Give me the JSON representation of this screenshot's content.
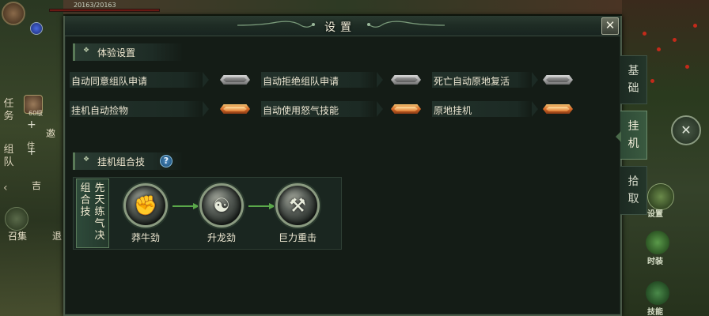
{
  "hud": {
    "hp_text": "20163/20163",
    "left_tabs": [
      "任务",
      "组队"
    ],
    "player_level": "60级",
    "left_menu": [
      "邀",
      "住",
      "吉"
    ],
    "left_bottom": [
      "召集",
      "退"
    ],
    "right_labels": [
      "设置",
      "时装",
      "技能"
    ]
  },
  "panel": {
    "title": "设置",
    "close_glyph": "✕"
  },
  "experience": {
    "heading": "体验设置",
    "options": [
      {
        "label": "自动同意组队申请",
        "on": false
      },
      {
        "label": "自动拒绝组队申请",
        "on": false
      },
      {
        "label": "死亡自动原地复活",
        "on": false
      },
      {
        "label": "挂机自动捡物",
        "on": true
      },
      {
        "label": "自动使用怒气技能",
        "on": true
      },
      {
        "label": "原地挂机",
        "on": true
      }
    ]
  },
  "combo": {
    "heading": "挂机组合技",
    "help_glyph": "?",
    "tab_col1": "组合技",
    "tab_col2": "先天练气决",
    "skills": [
      {
        "name": "莽牛劲",
        "icon": "fist-icon",
        "glyph": "✊"
      },
      {
        "name": "升龙劲",
        "icon": "dragon-icon",
        "glyph": "☯"
      },
      {
        "name": "巨力重击",
        "icon": "hammer-icon",
        "glyph": "⚒"
      }
    ]
  },
  "side_tabs": [
    {
      "label": "基础",
      "active": false
    },
    {
      "label": "挂机",
      "active": true
    },
    {
      "label": "拾取",
      "active": false
    }
  ],
  "colors": {
    "toggle_on": "#d86a28",
    "toggle_off": "#a8a8a8",
    "panel_bg": "#141c16",
    "accent_green": "#5a7a58"
  }
}
